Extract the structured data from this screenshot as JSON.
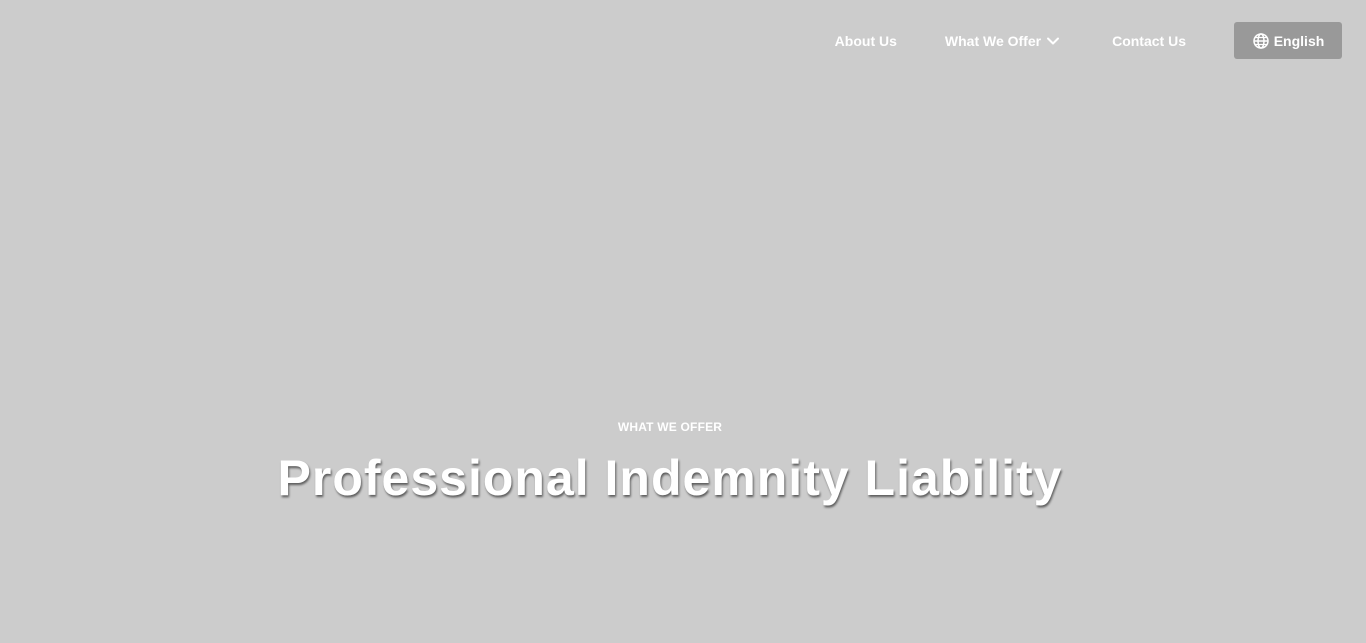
{
  "nav": {
    "about": "About Us",
    "offer": "What We Offer",
    "offer_icon": "chevron-down-icon",
    "contact": "Contact Us",
    "language": "English",
    "language_icon": "globe-icon"
  },
  "hero": {
    "eyebrow": "WHAT WE OFFER",
    "title": "Professional Indemnity Liability"
  },
  "colors": {
    "background": "#cccccc",
    "language_button": "#999999",
    "text": "#ffffff"
  }
}
